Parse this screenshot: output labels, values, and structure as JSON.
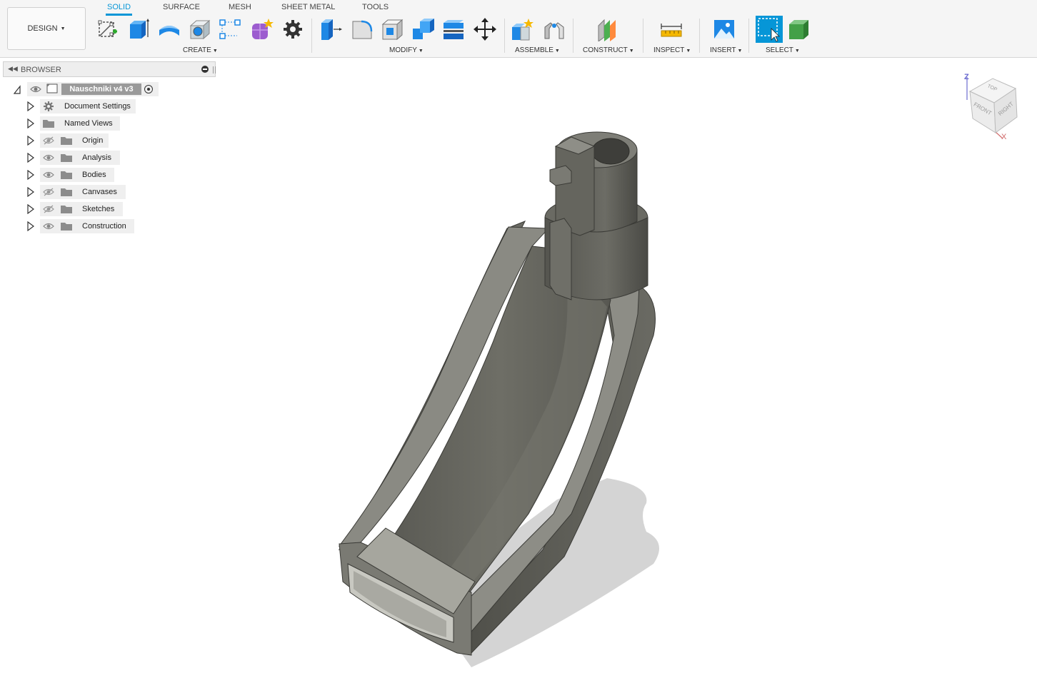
{
  "workspace": {
    "label": "DESIGN"
  },
  "tabs": [
    {
      "label": "SOLID",
      "active": true
    },
    {
      "label": "SURFACE",
      "active": false
    },
    {
      "label": "MESH",
      "active": false
    },
    {
      "label": "SHEET METAL",
      "active": false
    },
    {
      "label": "TOOLS",
      "active": false
    }
  ],
  "groups": {
    "create": "CREATE",
    "modify": "MODIFY",
    "assemble": "ASSEMBLE",
    "construct": "CONSTRUCT",
    "inspect": "INSPECT",
    "insert": "INSERT",
    "select": "SELECT"
  },
  "icons": {
    "create": [
      "sketch-icon",
      "extrude-icon",
      "revolve-icon",
      "hole-icon",
      "pattern-icon",
      "form-icon",
      "gear-icon"
    ],
    "modify": [
      "press-pull-icon",
      "fillet-icon",
      "shell-icon",
      "combine-icon",
      "split-icon",
      "move-icon"
    ],
    "assemble": [
      "new-component-icon",
      "joint-icon"
    ],
    "construct": [
      "offset-plane-icon"
    ],
    "inspect": [
      "measure-icon"
    ],
    "insert": [
      "insert-image-icon"
    ],
    "select": [
      "select-window-icon",
      "select-body-icon"
    ]
  },
  "browser": {
    "title": "BROWSER",
    "root": {
      "label": "Nauschniki v4 v3"
    },
    "items": [
      {
        "label": "Document Settings",
        "icon": "gear-icon",
        "eye": "none"
      },
      {
        "label": "Named Views",
        "icon": "folder-icon",
        "eye": "none"
      },
      {
        "label": "Origin",
        "icon": "folder-icon",
        "eye": "hidden"
      },
      {
        "label": "Analysis",
        "icon": "folder-icon",
        "eye": "visible"
      },
      {
        "label": "Bodies",
        "icon": "folder-icon",
        "eye": "visible"
      },
      {
        "label": "Canvases",
        "icon": "folder-icon",
        "eye": "hidden"
      },
      {
        "label": "Sketches",
        "icon": "folder-icon",
        "eye": "hidden"
      },
      {
        "label": "Construction",
        "icon": "folder-icon",
        "eye": "visible"
      }
    ]
  },
  "viewcube": {
    "top": "TOP",
    "front": "FRONT",
    "right": "RIGHT",
    "z": "Z",
    "x": "X"
  },
  "colors": {
    "accent": "#0696d7",
    "model_dark": "#5e5e58",
    "model_light": "#9a9a94"
  }
}
